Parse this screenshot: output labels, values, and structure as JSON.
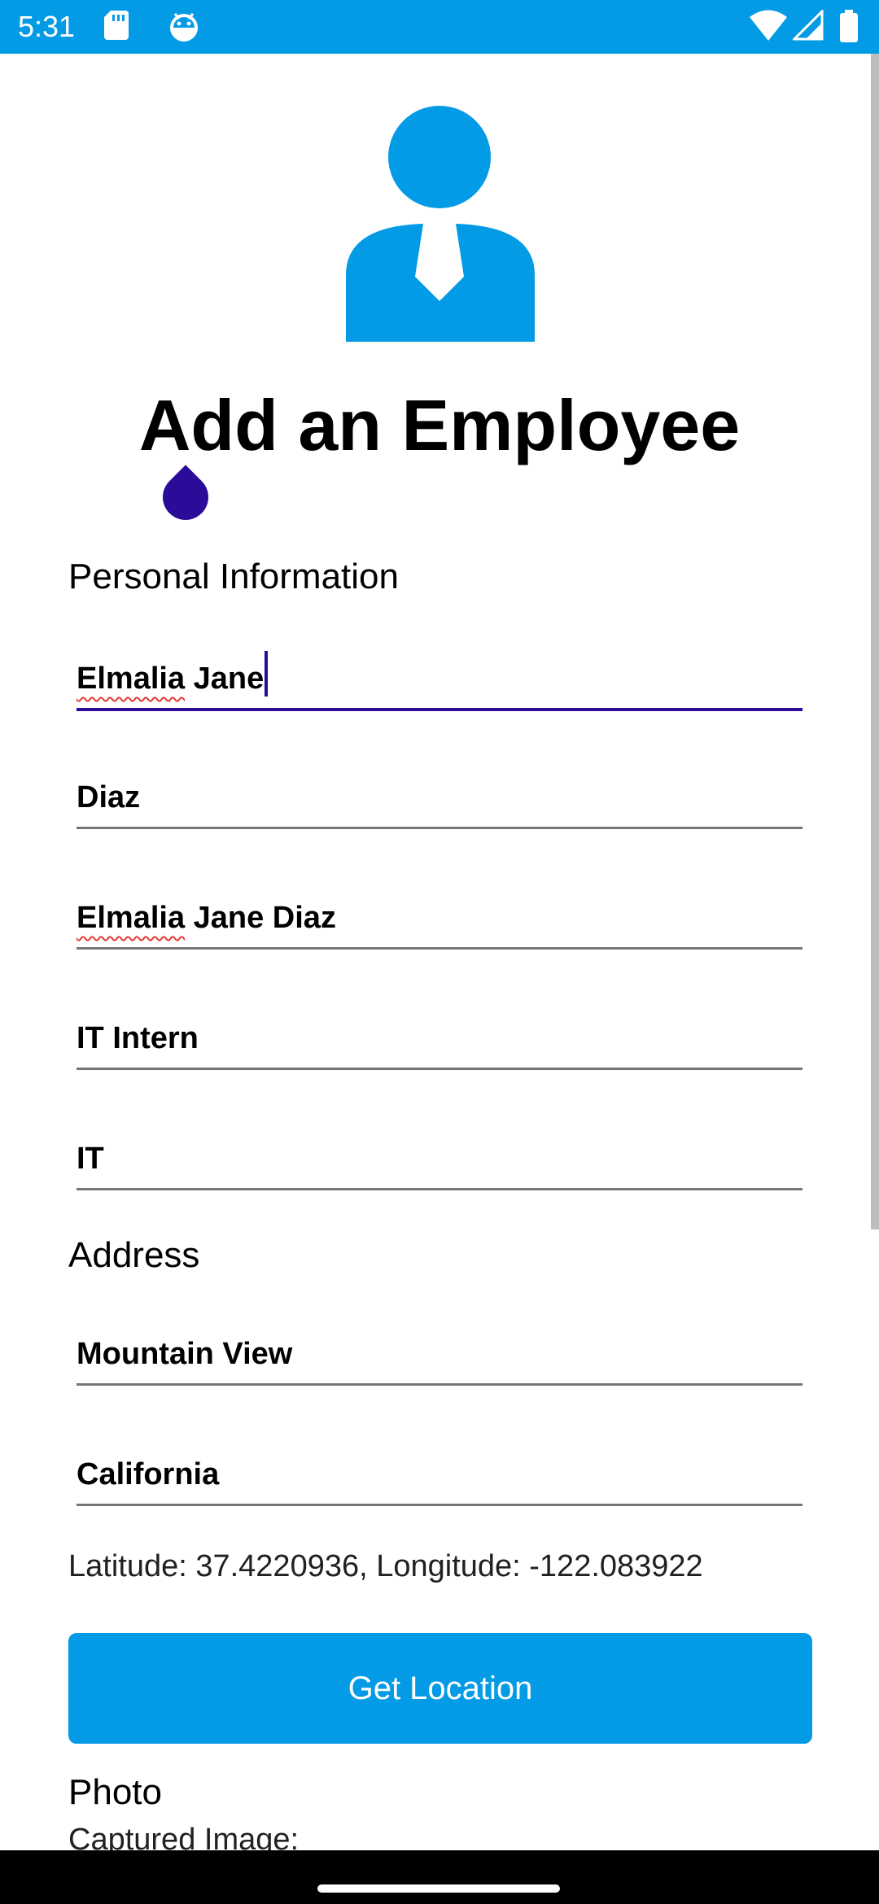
{
  "status_bar": {
    "time": "5:31",
    "left_icons": [
      "sd-card-icon",
      "android-debug-icon"
    ],
    "right_icons": [
      "wifi-icon",
      "cellular-signal-icon",
      "battery-icon"
    ]
  },
  "header": {
    "avatar_icon": "employee-avatar-icon",
    "title": "Add an Employee"
  },
  "personal": {
    "section_title": "Personal Information",
    "first_name": {
      "part1": "Elmalia",
      "part2": " Jane"
    },
    "last_name": "Diaz",
    "full_name": {
      "part1": "Elmalia",
      "part2": " Jane Diaz"
    },
    "job_title": "IT Intern",
    "department": "IT"
  },
  "address": {
    "section_title": "Address",
    "city": "Mountain View",
    "state": "California",
    "coordinates": "Latitude: 37.4220936, Longitude: -122.083922",
    "get_location_label": "Get Location"
  },
  "photo": {
    "section_title": "Photo",
    "captured_label": "Captured Image:"
  },
  "colors": {
    "accent": "#039be5",
    "focus": "#2a0c98",
    "spell_error": "#e53935"
  }
}
